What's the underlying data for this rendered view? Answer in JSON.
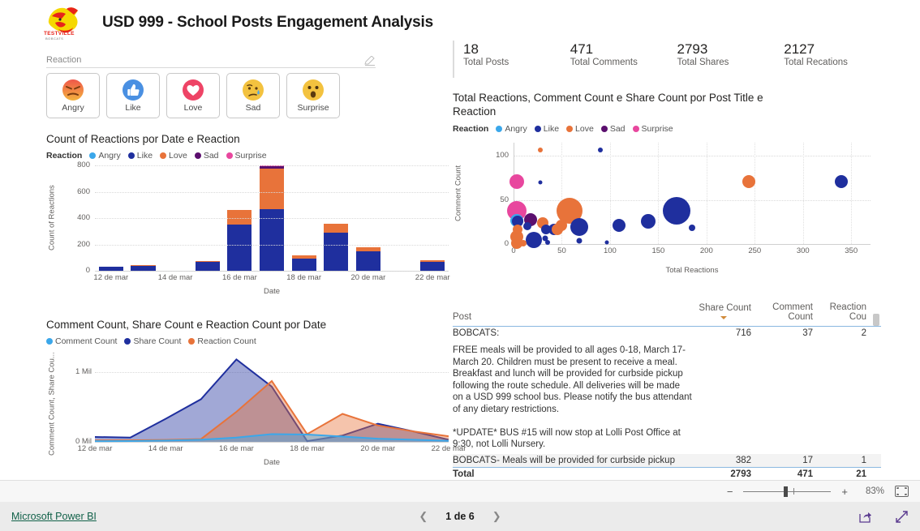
{
  "header": {
    "title": "USD 999 - School Posts Engagement Analysis",
    "logo_text": "TESTVILLE",
    "logo_subtext": "BOBCATS"
  },
  "slicer": {
    "label": "Reaction",
    "eraser_icon": "eraser-icon",
    "tiles": [
      {
        "label": "Angry",
        "icon": "angry-emoji"
      },
      {
        "label": "Like",
        "icon": "thumbs-up-emoji"
      },
      {
        "label": "Love",
        "icon": "heart-emoji"
      },
      {
        "label": "Sad",
        "icon": "sad-emoji"
      },
      {
        "label": "Surprise",
        "icon": "surprised-emoji"
      }
    ]
  },
  "kpis": [
    {
      "value": "18",
      "label": "Total Posts"
    },
    {
      "value": "471",
      "label": "Total Comments"
    },
    {
      "value": "2793",
      "label": "Total Shares"
    },
    {
      "value": "2127",
      "label": "Total Recations"
    }
  ],
  "right_title": "Total Reactions, Comment Count e Share Count por Post Title e Reaction",
  "legend_title": "Reaction",
  "colors": {
    "angry": "#3BA7EA",
    "like": "#1F2F9E",
    "love": "#E8733A",
    "sad": "#5B0F6E",
    "surprise": "#E8479E",
    "comment": "#3BA7EA",
    "share": "#1F2F9E",
    "reaction": "#E8733A",
    "accent_link": "#116149"
  },
  "table": {
    "columns": [
      "Post",
      "Share Count",
      "Comment Count",
      "Reaction Cou"
    ],
    "sorted_column": "Share Count",
    "rows": [
      {
        "post": "BOBCATS:",
        "share": "716",
        "comment": "37",
        "reaction": "2",
        "body": "FREE meals will be provided to all ages 0-18, March 17-\nMarch 20. Children must be present to receive a meal.\nBreakfast and lunch will be provided for curbside pickup\nfollowing the route schedule. All deliveries will be made\non a USD 999 school bus. Please notify the bus attendant\nof any dietary restrictions.\n\n*UPDATE* BUS #15 will now stop at Lolli Post Office at\n9:30, not Lolli Nursery."
      },
      {
        "post": "BOBCATS- Meals will be provided for curbside pickup",
        "share": "382",
        "comment": "17",
        "reaction": "1",
        "body": ""
      }
    ],
    "total": {
      "post": "Total",
      "share": "2793",
      "comment": "471",
      "reaction": "21"
    }
  },
  "zoombar": {
    "minus": "−",
    "plus": "+",
    "percent": "83%",
    "fit_icon": "fit-to-page-icon"
  },
  "footer": {
    "brand": "Microsoft Power BI",
    "prev_icon": "chevron-left-icon",
    "next_icon": "chevron-right-icon",
    "page_text": "1 de 6",
    "share_icon": "share-icon",
    "fullscreen_icon": "fullscreen-icon"
  },
  "chart_data": [
    {
      "type": "bar",
      "stacked": true,
      "title": "Count of Reactions por Date e Reaction",
      "xlabel": "Date",
      "ylabel": "Count of Reactions",
      "ylim": [
        0,
        800
      ],
      "yticks": [
        0,
        200,
        400,
        600,
        800
      ],
      "xticks": [
        "12 de mar",
        "14 de mar",
        "16 de mar",
        "18 de mar",
        "20 de mar",
        "22 de mar"
      ],
      "grid": true,
      "legend_position": "top",
      "categories": [
        "12 de mar",
        "13 de mar",
        "14 de mar",
        "15 de mar",
        "16 de mar",
        "17 de mar",
        "18 de mar",
        "19 de mar",
        "20 de mar",
        "21 de mar",
        "22 de mar"
      ],
      "series": [
        {
          "name": "Angry",
          "color": "#3BA7EA",
          "values": [
            0,
            0,
            0,
            0,
            0,
            0,
            0,
            0,
            0,
            0,
            0
          ]
        },
        {
          "name": "Like",
          "color": "#1F2F9E",
          "values": [
            30,
            40,
            0,
            70,
            352,
            470,
            90,
            290,
            145,
            0,
            65
          ]
        },
        {
          "name": "Love",
          "color": "#E8733A",
          "values": [
            2,
            2,
            0,
            6,
            112,
            305,
            30,
            70,
            35,
            0,
            15
          ]
        },
        {
          "name": "Sad",
          "color": "#5B0F6E",
          "values": [
            0,
            0,
            0,
            0,
            0,
            18,
            0,
            0,
            0,
            0,
            0
          ]
        },
        {
          "name": "Surprise",
          "color": "#E8479E",
          "values": [
            0,
            0,
            0,
            0,
            0,
            5,
            0,
            0,
            0,
            0,
            0
          ]
        }
      ]
    },
    {
      "type": "area",
      "title": "Comment Count, Share Count e Reaction Count por Date",
      "xlabel": "Date",
      "ylabel": "Comment Count, Share Cou...",
      "ylim": [
        0,
        1300000
      ],
      "yticks": [
        0,
        1000000
      ],
      "ytick_labels": [
        "0 Mil",
        "1 Mil"
      ],
      "xticks": [
        "12 de mar",
        "14 de mar",
        "16 de mar",
        "18 de mar",
        "20 de mar",
        "22 de mar"
      ],
      "grid": true,
      "legend_position": "top",
      "x": [
        "12 de mar",
        "13 de mar",
        "14 de mar",
        "15 de mar",
        "16 de mar",
        "17 de mar",
        "18 de mar",
        "19 de mar",
        "20 de mar",
        "21 de mar",
        "22 de mar"
      ],
      "series": [
        {
          "name": "Comment Count",
          "color": "#3BA7EA",
          "values": [
            10000,
            12000,
            18000,
            30000,
            60000,
            110000,
            105000,
            75000,
            45000,
            30000,
            15000
          ]
        },
        {
          "name": "Share Count",
          "color": "#1F2F9E",
          "values": [
            70000,
            60000,
            330000,
            610000,
            1180000,
            790000,
            10000,
            90000,
            260000,
            150000,
            30000
          ]
        },
        {
          "name": "Reaction Count",
          "color": "#E8733A",
          "values": [
            20000,
            22000,
            28000,
            40000,
            430000,
            870000,
            110000,
            400000,
            235000,
            150000,
            80000
          ]
        }
      ]
    },
    {
      "type": "scatter",
      "title": "Total Reactions, Comment Count e Share Count por Post Title e Reaction",
      "xlabel": "Total Reactions",
      "ylabel": "Comment Count",
      "xlim": [
        0,
        370
      ],
      "ylim": [
        0,
        115
      ],
      "xticks": [
        0,
        50,
        100,
        150,
        200,
        250,
        300,
        350
      ],
      "yticks": [
        0,
        50,
        100
      ],
      "grid": true,
      "size_field": "Share Count",
      "legend_position": "top",
      "points": [
        {
          "x": 28,
          "y": 107,
          "r": 3,
          "series": "Love"
        },
        {
          "x": 90,
          "y": 107,
          "r": 3,
          "series": "Like"
        },
        {
          "x": 3,
          "y": 71,
          "r": 9,
          "series": "Surprise"
        },
        {
          "x": 28,
          "y": 70,
          "r": 2.5,
          "series": "Like"
        },
        {
          "x": 244,
          "y": 71,
          "r": 8,
          "series": "Love"
        },
        {
          "x": 340,
          "y": 71,
          "r": 8,
          "series": "Like"
        },
        {
          "x": 3,
          "y": 38,
          "r": 12,
          "series": "Surprise"
        },
        {
          "x": 58,
          "y": 38,
          "r": 16,
          "series": "Love"
        },
        {
          "x": 169,
          "y": 38,
          "r": 17,
          "series": "Like"
        },
        {
          "x": 3,
          "y": 27,
          "r": 8,
          "series": "Angry"
        },
        {
          "x": 4,
          "y": 26,
          "r": 7,
          "series": "Like"
        },
        {
          "x": 18,
          "y": 28,
          "r": 8,
          "series": "Sad"
        },
        {
          "x": 140,
          "y": 26,
          "r": 9,
          "series": "Like"
        },
        {
          "x": 30,
          "y": 24,
          "r": 7,
          "series": "Love"
        },
        {
          "x": 109,
          "y": 21,
          "r": 8,
          "series": "Like"
        },
        {
          "x": 50,
          "y": 21,
          "r": 7,
          "series": "Love"
        },
        {
          "x": 68,
          "y": 19,
          "r": 11,
          "series": "Like"
        },
        {
          "x": 185,
          "y": 18,
          "r": 4,
          "series": "Like"
        },
        {
          "x": 4,
          "y": 17,
          "r": 6,
          "series": "Love"
        },
        {
          "x": 14,
          "y": 20,
          "r": 5,
          "series": "Like"
        },
        {
          "x": 34,
          "y": 17,
          "r": 6,
          "series": "Like"
        },
        {
          "x": 42,
          "y": 17,
          "r": 7,
          "series": "Like"
        },
        {
          "x": 45,
          "y": 17,
          "r": 7,
          "series": "Love"
        },
        {
          "x": 3,
          "y": 8,
          "r": 8,
          "series": "Love"
        },
        {
          "x": 21,
          "y": 5,
          "r": 10,
          "series": "Like"
        },
        {
          "x": 33,
          "y": 6,
          "r": 3.5,
          "series": "Like"
        },
        {
          "x": 35,
          "y": 2,
          "r": 3,
          "series": "Like"
        },
        {
          "x": 68,
          "y": 4,
          "r": 3.5,
          "series": "Like"
        },
        {
          "x": 97,
          "y": 2,
          "r": 2.5,
          "series": "Like"
        },
        {
          "x": 3,
          "y": 1,
          "r": 7,
          "series": "Love"
        },
        {
          "x": 10,
          "y": 1,
          "r": 4,
          "series": "Love"
        }
      ]
    }
  ]
}
